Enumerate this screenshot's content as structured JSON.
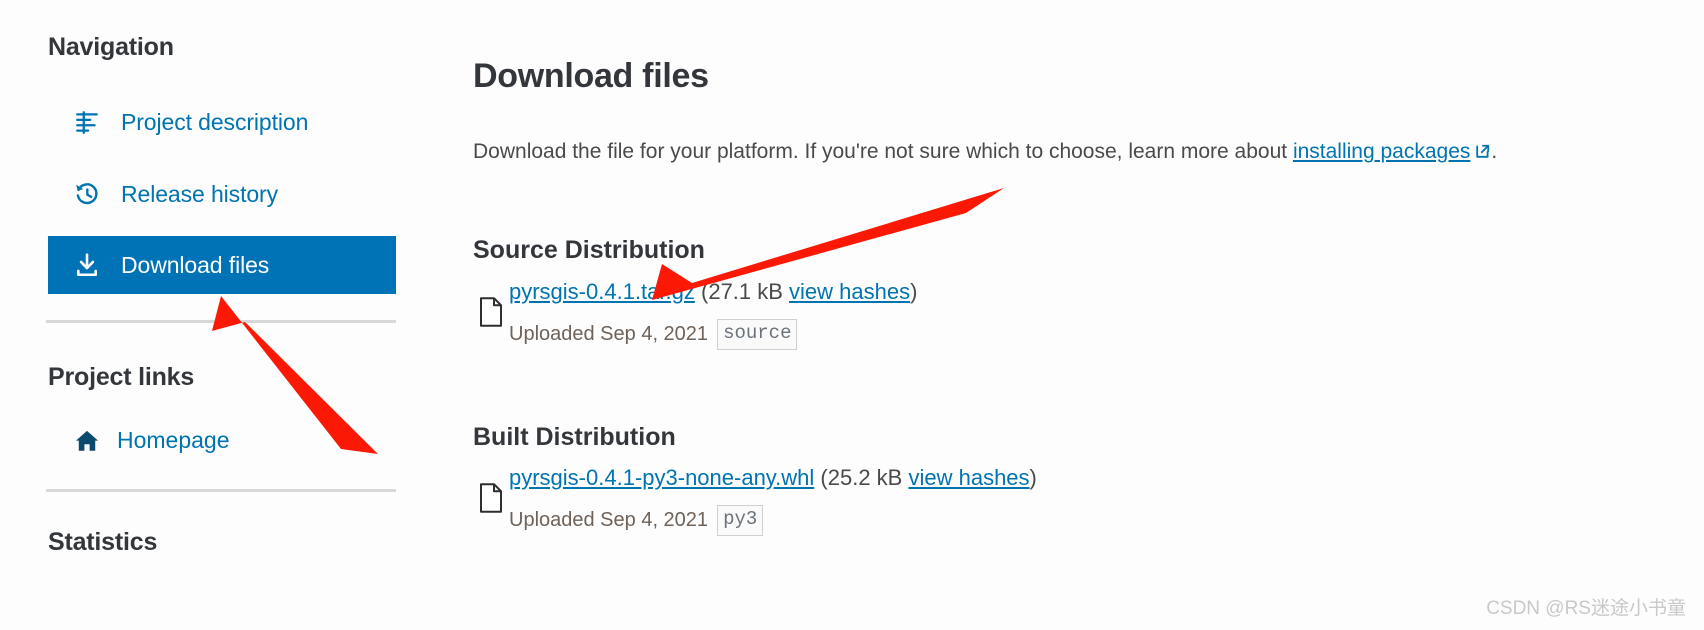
{
  "sidebar": {
    "nav_heading": "Navigation",
    "nav_items": [
      {
        "label": "Project description",
        "icon": "list-lines-icon",
        "active": false
      },
      {
        "label": "Release history",
        "icon": "history-clock-icon",
        "active": false
      },
      {
        "label": "Download files",
        "icon": "download-icon",
        "active": true
      }
    ],
    "links_heading": "Project links",
    "links": [
      {
        "label": "Homepage",
        "icon": "home-icon"
      }
    ],
    "stats_heading": "Statistics"
  },
  "main": {
    "title": "Download files",
    "intro": {
      "text_before": "Download the file for your platform. If you're not sure which to choose, learn more about ",
      "link_text": "installing packages",
      "link_icon": "external-link-icon",
      "text_after": "."
    },
    "sections": [
      {
        "heading": "Source Distribution",
        "file": {
          "icon": "file-document-icon",
          "filename": "pyrsgis-0.4.1.tar.gz",
          "size_open": " (",
          "size": "27.1 kB ",
          "hashes_link": "view hashes",
          "size_close": ")",
          "uploaded": "Uploaded Sep 4, 2021",
          "badge": "source"
        }
      },
      {
        "heading": "Built Distribution",
        "file": {
          "icon": "file-document-icon",
          "filename": "pyrsgis-0.4.1-py3-none-any.whl",
          "size_open": " (",
          "size": "25.2 kB ",
          "hashes_link": "view hashes",
          "size_close": ")",
          "uploaded": "Uploaded Sep 4, 2021",
          "badge": "py3"
        }
      }
    ]
  },
  "annotations": {
    "arrow_color": "#fb1905",
    "arrow_to_download_files": "red arrow pointing up-left at the highlighted Download files nav item",
    "arrow_to_targz": "red arrow pointing down-left at the pyrsgis-0.4.1.tar.gz link"
  },
  "watermark": {
    "text": "CSDN @RS迷途小书童"
  },
  "colors": {
    "accent_blue": "#0073b7",
    "link_blue": "#0073b1",
    "heading": "#33363b",
    "body_text": "#4a4a4a",
    "muted_text": "#6e6259",
    "divider": "#d8d8d8",
    "arrow_red": "#fb1905"
  }
}
